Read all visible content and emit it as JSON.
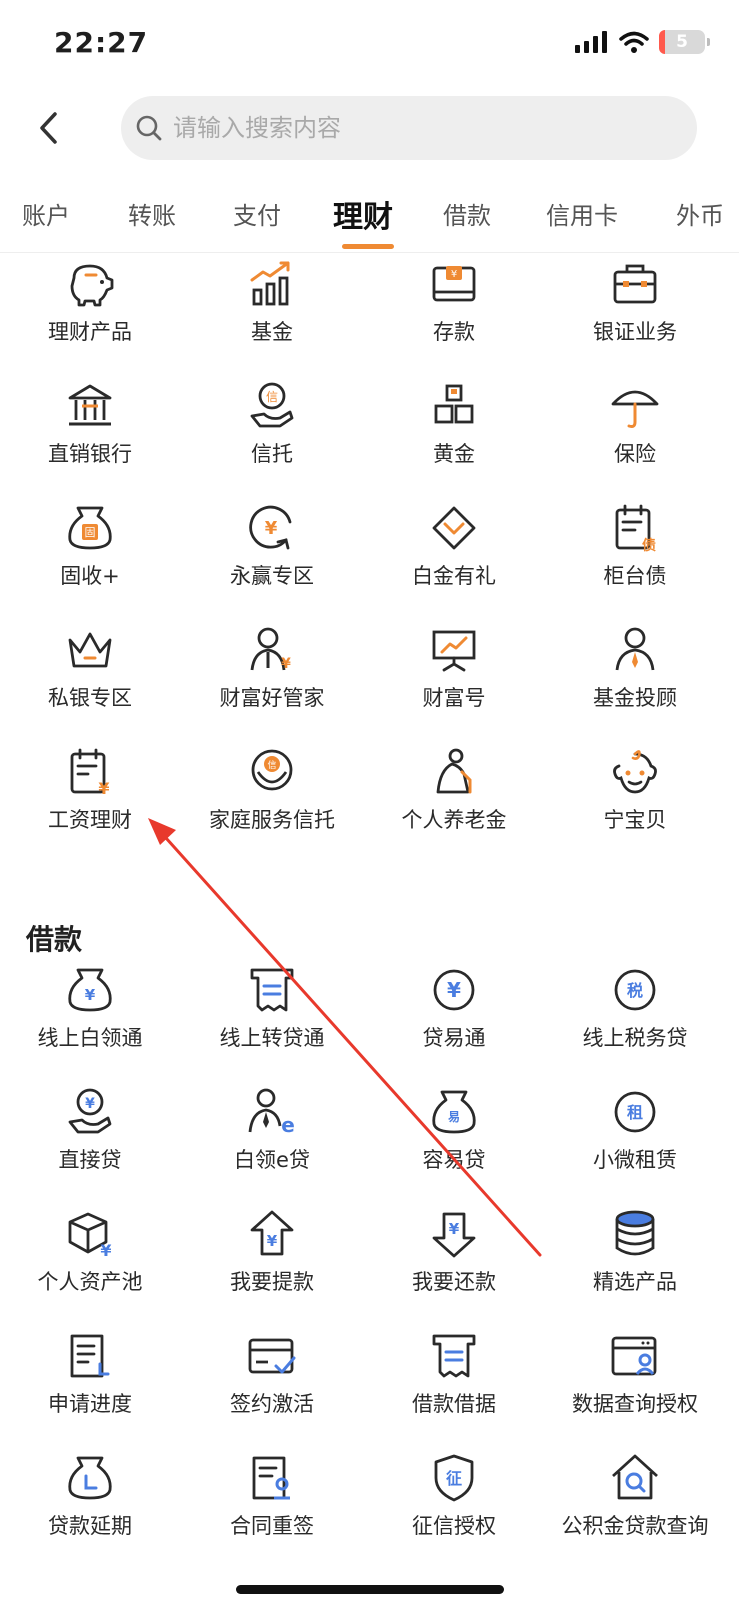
{
  "status_bar": {
    "time": "22:27",
    "battery": "5"
  },
  "search": {
    "placeholder": "请输入搜索内容"
  },
  "tabs": [
    {
      "label": "账户"
    },
    {
      "label": "转账"
    },
    {
      "label": "支付"
    },
    {
      "label": "理财",
      "active": true
    },
    {
      "label": "借款"
    },
    {
      "label": "信用卡"
    },
    {
      "label": "外币"
    }
  ],
  "wealth": {
    "items": [
      {
        "label": "理财产品",
        "icon": "piggy-bank-icon"
      },
      {
        "label": "基金",
        "icon": "fund-chart-icon"
      },
      {
        "label": "存款",
        "icon": "deposit-icon"
      },
      {
        "label": "银证业务",
        "icon": "briefcase-icon"
      },
      {
        "label": "直销银行",
        "icon": "bank-building-icon"
      },
      {
        "label": "信托",
        "icon": "trust-hand-icon"
      },
      {
        "label": "黄金",
        "icon": "gold-bars-icon"
      },
      {
        "label": "保险",
        "icon": "umbrella-icon"
      },
      {
        "label": "固收+",
        "icon": "fixed-income-bag-icon"
      },
      {
        "label": "永赢专区",
        "icon": "yen-cycle-icon"
      },
      {
        "label": "白金有礼",
        "icon": "diamond-icon"
      },
      {
        "label": "柜台债",
        "icon": "bond-calendar-icon"
      },
      {
        "label": "私银专区",
        "icon": "crown-icon"
      },
      {
        "label": "财富好管家",
        "icon": "butler-icon"
      },
      {
        "label": "财富号",
        "icon": "presentation-board-icon"
      },
      {
        "label": "基金投顾",
        "icon": "advisor-icon"
      },
      {
        "label": "工资理财",
        "icon": "salary-calendar-icon"
      },
      {
        "label": "家庭服务信托",
        "icon": "family-trust-icon"
      },
      {
        "label": "个人养老金",
        "icon": "elderly-pension-icon"
      },
      {
        "label": "宁宝贝",
        "icon": "baby-face-icon"
      }
    ]
  },
  "loans": {
    "title": "借款",
    "items": [
      {
        "label": "线上白领通",
        "icon": "money-bag-yen-icon"
      },
      {
        "label": "线上转贷通",
        "icon": "receipt-icon"
      },
      {
        "label": "贷易通",
        "icon": "yen-coin-icon"
      },
      {
        "label": "线上税务贷",
        "icon": "tax-coin-icon"
      },
      {
        "label": "直接贷",
        "icon": "coin-hand-icon"
      },
      {
        "label": "白领e贷",
        "icon": "white-collar-icon"
      },
      {
        "label": "容易贷",
        "icon": "easy-loan-bag-icon"
      },
      {
        "label": "小微租赁",
        "icon": "lease-coin-icon"
      },
      {
        "label": "个人资产池",
        "icon": "asset-box-icon"
      },
      {
        "label": "我要提款",
        "icon": "withdraw-arrow-icon"
      },
      {
        "label": "我要还款",
        "icon": "repay-arrow-icon"
      },
      {
        "label": "精选产品",
        "icon": "database-icon"
      },
      {
        "label": "申请进度",
        "icon": "progress-document-icon"
      },
      {
        "label": "签约激活",
        "icon": "card-check-icon"
      },
      {
        "label": "借款借据",
        "icon": "loan-receipt-icon"
      },
      {
        "label": "数据查询授权",
        "icon": "data-auth-icon"
      },
      {
        "label": "贷款延期",
        "icon": "loan-extension-bag-icon"
      },
      {
        "label": "合同重签",
        "icon": "contract-sign-icon"
      },
      {
        "label": "征信授权",
        "icon": "credit-shield-icon"
      },
      {
        "label": "公积金贷款查询",
        "icon": "housing-fund-search-icon"
      }
    ]
  },
  "colors": {
    "accent": "#ef8a33",
    "loan_accent": "#4a7de0",
    "icon_dark": "#2a2a2a",
    "annotation": "#e8392c"
  }
}
